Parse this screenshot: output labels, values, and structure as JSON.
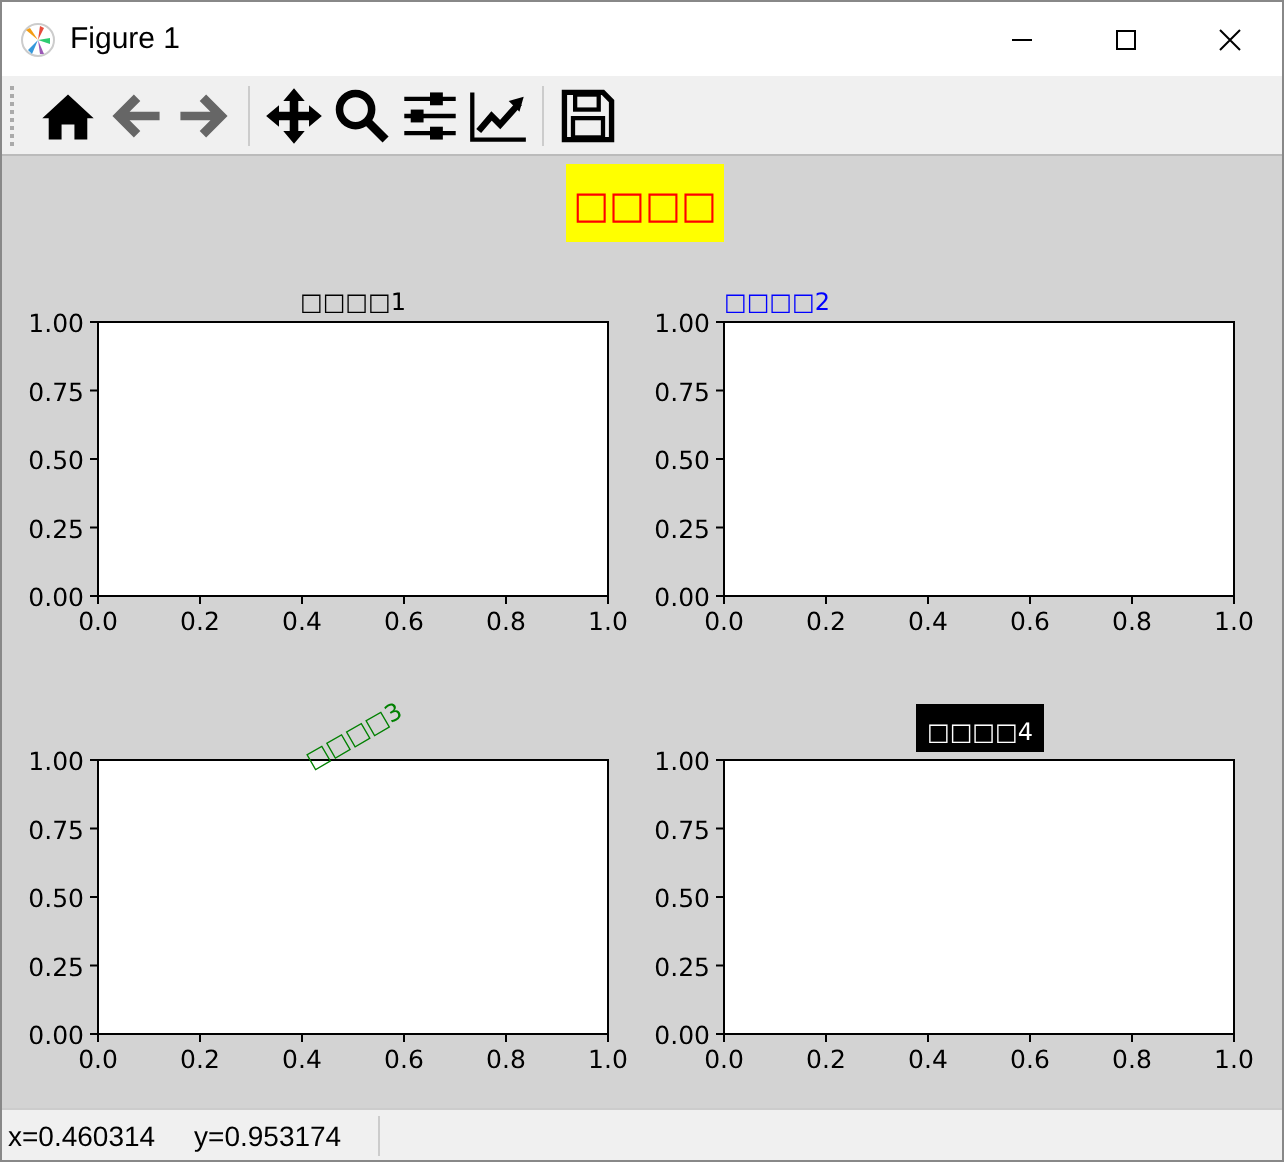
{
  "window": {
    "title": "Figure 1"
  },
  "figure": {
    "suptitle": "□□□□",
    "subplots": [
      {
        "kind": "center",
        "color": "#000000",
        "chart_data": {
          "type": "line",
          "title": "□□□□1",
          "xlim": [
            0,
            1
          ],
          "ylim": [
            0,
            1
          ],
          "xticks": [
            {
              "value": 0,
              "label": "0.0"
            },
            {
              "value": 0.2,
              "label": "0.2"
            },
            {
              "value": 0.4,
              "label": "0.4"
            },
            {
              "value": 0.6,
              "label": "0.6"
            },
            {
              "value": 0.8,
              "label": "0.8"
            },
            {
              "value": 1,
              "label": "1.0"
            }
          ],
          "yticks": [
            {
              "value": 0,
              "label": "0.00"
            },
            {
              "value": 0.25,
              "label": "0.25"
            },
            {
              "value": 0.5,
              "label": "0.50"
            },
            {
              "value": 0.75,
              "label": "0.75"
            },
            {
              "value": 1,
              "label": "1.00"
            }
          ]
        }
      },
      {
        "kind": "left",
        "color": "#0000ff",
        "chart_data": {
          "type": "line",
          "title": "□□□□2",
          "xlim": [
            0,
            1
          ],
          "ylim": [
            0,
            1
          ],
          "xticks": [
            {
              "value": 0,
              "label": "0.0"
            },
            {
              "value": 0.2,
              "label": "0.2"
            },
            {
              "value": 0.4,
              "label": "0.4"
            },
            {
              "value": 0.6,
              "label": "0.6"
            },
            {
              "value": 0.8,
              "label": "0.8"
            },
            {
              "value": 1,
              "label": "1.0"
            }
          ],
          "yticks": [
            {
              "value": 0,
              "label": "0.00"
            },
            {
              "value": 0.25,
              "label": "0.25"
            },
            {
              "value": 0.5,
              "label": "0.50"
            },
            {
              "value": 0.75,
              "label": "0.75"
            },
            {
              "value": 1,
              "label": "1.00"
            }
          ]
        }
      },
      {
        "kind": "rotated",
        "color": "#008000",
        "chart_data": {
          "type": "line",
          "title": "□□□□3",
          "xlim": [
            0,
            1
          ],
          "ylim": [
            0,
            1
          ],
          "xticks": [
            {
              "value": 0,
              "label": "0.0"
            },
            {
              "value": 0.2,
              "label": "0.2"
            },
            {
              "value": 0.4,
              "label": "0.4"
            },
            {
              "value": 0.6,
              "label": "0.6"
            },
            {
              "value": 0.8,
              "label": "0.8"
            },
            {
              "value": 1,
              "label": "1.0"
            }
          ],
          "yticks": [
            {
              "value": 0,
              "label": "0.00"
            },
            {
              "value": 0.25,
              "label": "0.25"
            },
            {
              "value": 0.5,
              "label": "0.50"
            },
            {
              "value": 0.75,
              "label": "0.75"
            },
            {
              "value": 1,
              "label": "1.00"
            }
          ]
        }
      },
      {
        "kind": "boxed",
        "color": "#ffffff",
        "chart_data": {
          "type": "line",
          "title": "□□□□4",
          "xlim": [
            0,
            1
          ],
          "ylim": [
            0,
            1
          ],
          "xticks": [
            {
              "value": 0,
              "label": "0.0"
            },
            {
              "value": 0.2,
              "label": "0.2"
            },
            {
              "value": 0.4,
              "label": "0.4"
            },
            {
              "value": 0.6,
              "label": "0.6"
            },
            {
              "value": 0.8,
              "label": "0.8"
            },
            {
              "value": 1,
              "label": "1.0"
            }
          ],
          "yticks": [
            {
              "value": 0,
              "label": "0.00"
            },
            {
              "value": 0.25,
              "label": "0.25"
            },
            {
              "value": 0.5,
              "label": "0.50"
            },
            {
              "value": 0.75,
              "label": "0.75"
            },
            {
              "value": 1,
              "label": "1.00"
            }
          ]
        }
      }
    ]
  },
  "status_bar": {
    "text": "x=0.460314     y=0.953174"
  }
}
